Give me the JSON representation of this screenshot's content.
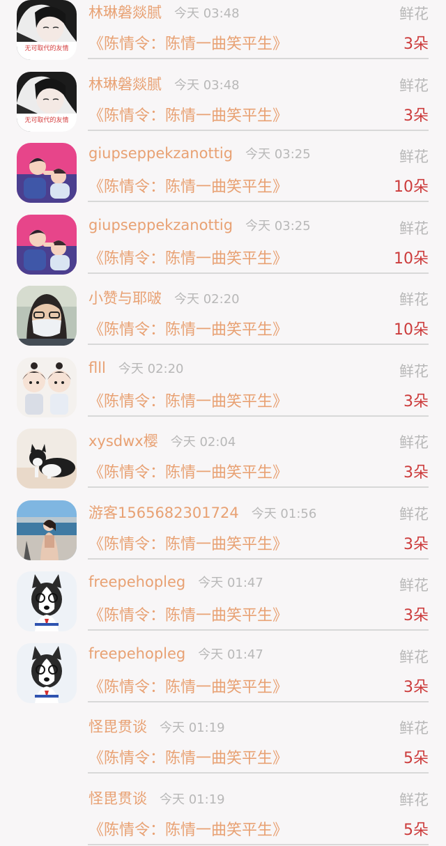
{
  "gift_label": "鲜花",
  "avatar_texts": {
    "friendship": "无可取代的友情"
  },
  "colors": {
    "name": "#e8a173",
    "time": "#b8b8b8",
    "count": "#cc3b3b",
    "divider": "#d8d8d8"
  },
  "rows": [
    {
      "user": "林琳磐燚腻",
      "time": "今天 03:48",
      "book": "《陈情令：陈情一曲笑平生》",
      "count": "3朵",
      "avatar": "girl-bw-avatar"
    },
    {
      "user": "林琳磐燚腻",
      "time": "今天 03:48",
      "book": "《陈情令：陈情一曲笑平生》",
      "count": "3朵",
      "avatar": "girl-bw-avatar"
    },
    {
      "user": "giupseppekzanottig",
      "time": "今天 03:25",
      "book": "《陈情令：陈情一曲笑平生》",
      "count": "10朵",
      "avatar": "couple-cartoon-avatar"
    },
    {
      "user": "giupseppekzanottig",
      "time": "今天 03:25",
      "book": "《陈情令：陈情一曲笑平生》",
      "count": "10朵",
      "avatar": "couple-cartoon-avatar"
    },
    {
      "user": "小赞与耶啵",
      "time": "今天 02:20",
      "book": "《陈情令：陈情一曲笑平生》",
      "count": "10朵",
      "avatar": "masked-person-avatar"
    },
    {
      "user": "flll",
      "time": "今天 02:20",
      "book": "《陈情令：陈情一曲笑平生》",
      "count": "3朵",
      "avatar": "chibi-pair-avatar"
    },
    {
      "user": "xysdwx樱",
      "time": "今天 02:04",
      "book": "《陈情令：陈情一曲笑平生》",
      "count": "3朵",
      "avatar": "cat-photo-avatar"
    },
    {
      "user": "游客1565682301724",
      "time": "今天 01:56",
      "book": "《陈情令：陈情一曲笑平生》",
      "count": "3朵",
      "avatar": "seaside-photo-avatar"
    },
    {
      "user": "freepehopleg",
      "time": "今天 01:47",
      "book": "《陈情令：陈情一曲笑平生》",
      "count": "3朵",
      "avatar": "husky-dog-avatar"
    },
    {
      "user": "freepehopleg",
      "time": "今天 01:47",
      "book": "《陈情令：陈情一曲笑平生》",
      "count": "3朵",
      "avatar": "husky-dog-avatar"
    },
    {
      "user": "怪毘贯谈",
      "time": "今天 01:19",
      "book": "《陈情令：陈情一曲笑平生》",
      "count": "5朵",
      "avatar": "none"
    },
    {
      "user": "怪毘贯谈",
      "time": "今天 01:19",
      "book": "《陈情令：陈情一曲笑平生》",
      "count": "5朵",
      "avatar": "none"
    }
  ]
}
